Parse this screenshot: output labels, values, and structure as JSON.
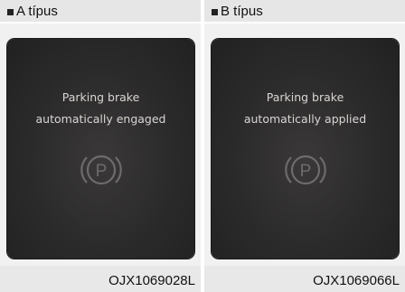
{
  "panels": [
    {
      "header": "A típus",
      "message_line1": "Parking brake",
      "message_line2": "automatically engaged",
      "icon": "parking-brake-icon",
      "caption": "OJX1069028L"
    },
    {
      "header": "B típus",
      "message_line1": "Parking brake",
      "message_line2": "automatically applied",
      "icon": "parking-brake-icon",
      "caption": "OJX1069066L"
    }
  ],
  "colors": {
    "screen_bg": "#2b2a2a",
    "message_text": "#d9d6d3",
    "icon_stroke": "#6e6c6b",
    "panel_bg": "#e8e8e8"
  }
}
